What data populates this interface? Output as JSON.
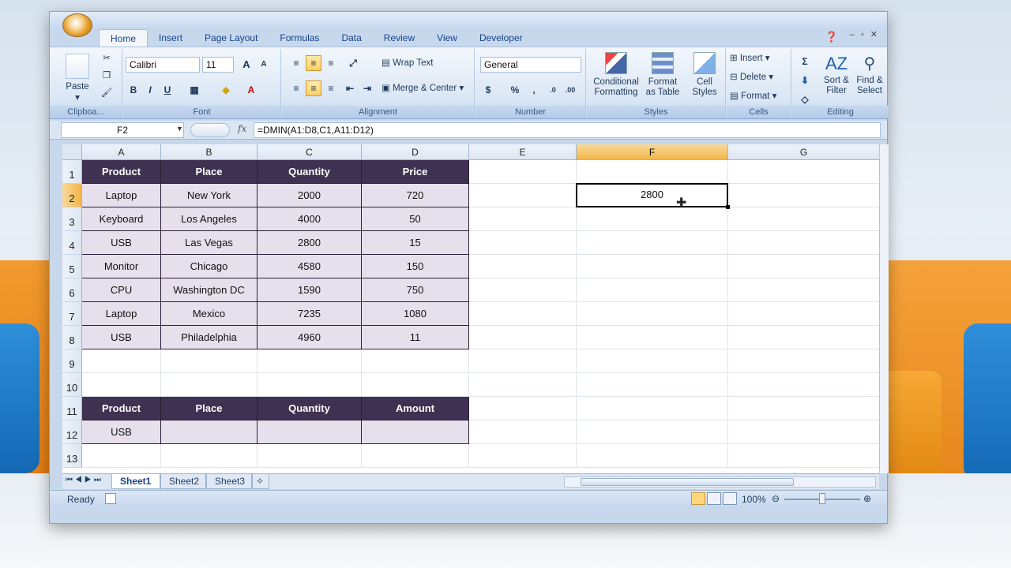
{
  "ribbon_tabs": [
    "Home",
    "Insert",
    "Page Layout",
    "Formulas",
    "Data",
    "Review",
    "View",
    "Developer"
  ],
  "active_tab": "Home",
  "clipboard": {
    "paste": "Paste",
    "label": "Clipboa..."
  },
  "font": {
    "name": "Calibri",
    "size": "11",
    "label": "Font",
    "bold": "B",
    "italic": "I",
    "underline": "U",
    "grow": "A",
    "shrink": "A"
  },
  "alignment": {
    "wrap": "Wrap Text",
    "merge": "Merge & Center",
    "label": "Alignment"
  },
  "number": {
    "format": "General",
    "currency": "$",
    "percent": "%",
    "comma": ",",
    "inc": ".0",
    "dec": ".00",
    "label": "Number"
  },
  "styles": {
    "cond": "Conditional",
    "cond2": "Formatting",
    "table": "Format",
    "table2": "as Table",
    "cell": "Cell",
    "cell2": "Styles",
    "label": "Styles"
  },
  "cells": {
    "insert": "Insert",
    "delete": "Delete",
    "format": "Format",
    "label": "Cells"
  },
  "editing": {
    "sort": "Sort &",
    "sort2": "Filter",
    "find": "Find &",
    "find2": "Select",
    "label": "Editing"
  },
  "formula_bar": {
    "name_box": "F2",
    "fx": "fx",
    "formula": "=DMIN(A1:D8,C1,A11:D12)"
  },
  "columns": [
    "A",
    "B",
    "C",
    "D",
    "E",
    "F",
    "G"
  ],
  "rows": [
    "1",
    "2",
    "3",
    "4",
    "5",
    "6",
    "7",
    "8",
    "9",
    "10",
    "11",
    "12",
    "13"
  ],
  "table1": {
    "headers": [
      "Product",
      "Place",
      "Quantity",
      "Price"
    ],
    "rows": [
      [
        "Laptop",
        "New York",
        "2000",
        "720"
      ],
      [
        "Keyboard",
        "Los Angeles",
        "4000",
        "50"
      ],
      [
        "USB",
        "Las Vegas",
        "2800",
        "15"
      ],
      [
        "Monitor",
        "Chicago",
        "4580",
        "150"
      ],
      [
        "CPU",
        "Washington DC",
        "1590",
        "750"
      ],
      [
        "Laptop",
        "Mexico",
        "7235",
        "1080"
      ],
      [
        "USB",
        "Philadelphia",
        "4960",
        "11"
      ]
    ]
  },
  "table2": {
    "headers": [
      "Product",
      "Place",
      "Quantity",
      "Amount"
    ],
    "rows": [
      [
        "USB",
        "",
        "",
        ""
      ]
    ]
  },
  "active_cell_value": "2800",
  "sheets": [
    "Sheet1",
    "Sheet2",
    "Sheet3"
  ],
  "active_sheet": "Sheet1",
  "status": {
    "ready": "Ready",
    "zoom": "100%"
  }
}
